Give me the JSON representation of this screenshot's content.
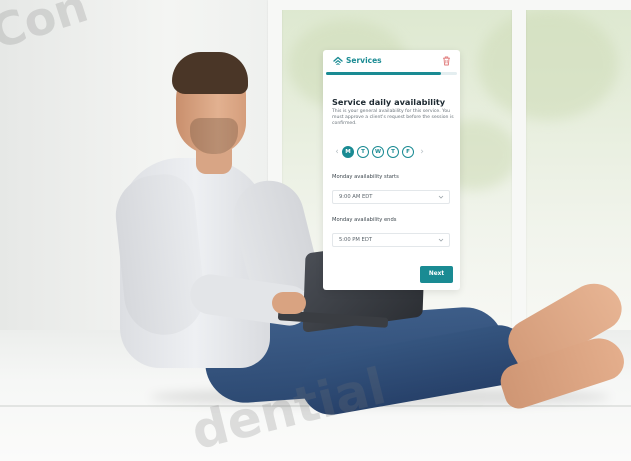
{
  "app": {
    "brand_name": "Services",
    "progress_percent": 88
  },
  "step": {
    "heading": "Service daily availability",
    "description": "This is your general availability for this service. You must approve a client's request before the session is confirmed."
  },
  "days": {
    "items": [
      "M",
      "T",
      "W",
      "T",
      "F"
    ],
    "selected_index": 0,
    "prev_arrow": "‹",
    "next_arrow": "›"
  },
  "fields": {
    "start_label": "Monday availability starts",
    "start_value": "9:00 AM EDT",
    "end_label": "Monday availability ends",
    "end_value": "5:00 PM EDT"
  },
  "actions": {
    "next_label": "Next"
  },
  "watermark": {
    "top_text": "Con",
    "bottom_text": "dential"
  },
  "colors": {
    "accent": "#1a8b93"
  },
  "icons": {
    "logo": "house-icon",
    "delete": "trash-icon",
    "select": "chevron-down-icon"
  }
}
